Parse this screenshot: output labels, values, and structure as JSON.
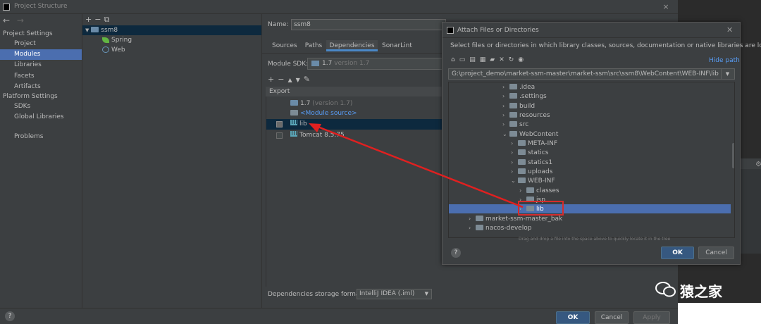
{
  "window": {
    "title": "Project Structure",
    "close_icon": "×"
  },
  "nav": {
    "back": "←",
    "forward": "→",
    "project_settings_header": "Project Settings",
    "items_project": [
      "Project",
      "Modules",
      "Libraries",
      "Facets",
      "Artifacts"
    ],
    "platform_settings_header": "Platform Settings",
    "items_platform": [
      "SDKs",
      "Global Libraries"
    ],
    "problems": "Problems",
    "selected": "Modules"
  },
  "module_tree": {
    "toolbar": [
      "+",
      "−",
      "⧉"
    ],
    "root": "ssm8",
    "children": [
      "Spring",
      "Web"
    ]
  },
  "module": {
    "name_label": "Name:",
    "name_value": "ssm8",
    "tabs": [
      "Sources",
      "Paths",
      "Dependencies",
      "SonarLint"
    ],
    "active_tab": "Dependencies",
    "sdk_label": "Module SDK:",
    "sdk_value": "1.7",
    "sdk_version": "version 1.7",
    "deps_toolbar": [
      "+",
      "−",
      "▲",
      "▼",
      "✎"
    ],
    "export_header": "Export",
    "deps": [
      {
        "name": "1.7",
        "extra": "(version 1.7)",
        "type": "sdk"
      },
      {
        "name": "<Module source>",
        "extra": "",
        "type": "source"
      },
      {
        "name": "lib",
        "extra": "",
        "type": "lib"
      },
      {
        "name": "Tomcat 8.5.75",
        "extra": "",
        "type": "lib"
      }
    ],
    "storage_label": "Dependencies storage format:",
    "storage_value": "IntelliJ IDEA (.iml)"
  },
  "buttons": {
    "ok": "OK",
    "cancel": "Cancel",
    "apply": "Apply",
    "help": "?"
  },
  "dialog": {
    "title": "Attach Files or Directories",
    "description": "Select files or directories in which library classes, sources, documentation or native libraries are located",
    "toolbar_icons": [
      "home-icon",
      "desktop-icon",
      "project-icon",
      "module-icon",
      "new-folder-icon",
      "delete-icon",
      "refresh-icon",
      "show-hidden-icon"
    ],
    "hide_path": "Hide path",
    "path": "G:\\project_demo\\market-ssm-master\\market-ssm\\src\\ssm8\\WebContent\\WEB-INF\\lib",
    "tree": [
      {
        "label": ".idea",
        "level": 0,
        "open": false
      },
      {
        "label": ".settings",
        "level": 0,
        "open": false
      },
      {
        "label": "build",
        "level": 0,
        "open": false
      },
      {
        "label": "resources",
        "level": 0,
        "open": false
      },
      {
        "label": "src",
        "level": 0,
        "open": false
      },
      {
        "label": "WebContent",
        "level": 0,
        "open": true
      },
      {
        "label": "META-INF",
        "level": 1,
        "open": false
      },
      {
        "label": "statics",
        "level": 1,
        "open": false
      },
      {
        "label": "statics1",
        "level": 1,
        "open": false
      },
      {
        "label": "uploads",
        "level": 1,
        "open": false
      },
      {
        "label": "WEB-INF",
        "level": 1,
        "open": true
      },
      {
        "label": "classes",
        "level": 2,
        "open": false
      },
      {
        "label": "jsp",
        "level": 2,
        "open": false
      },
      {
        "label": "lib",
        "level": 2,
        "open": false,
        "selected": true
      },
      {
        "label": "market-ssm-master_bak",
        "level": -2,
        "open": false
      },
      {
        "label": "nacos-develop",
        "level": -2,
        "open": false
      }
    ],
    "hint": "Drag and drop a file into the space above to quickly locate it in the tree",
    "ok": "OK",
    "cancel": "Cancel",
    "help": "?"
  },
  "watermark": {
    "brand": "猿之家"
  },
  "colors": {
    "selection": "#4b6eaf",
    "annotation": "#d62b2b",
    "background": "#3c3f41"
  }
}
